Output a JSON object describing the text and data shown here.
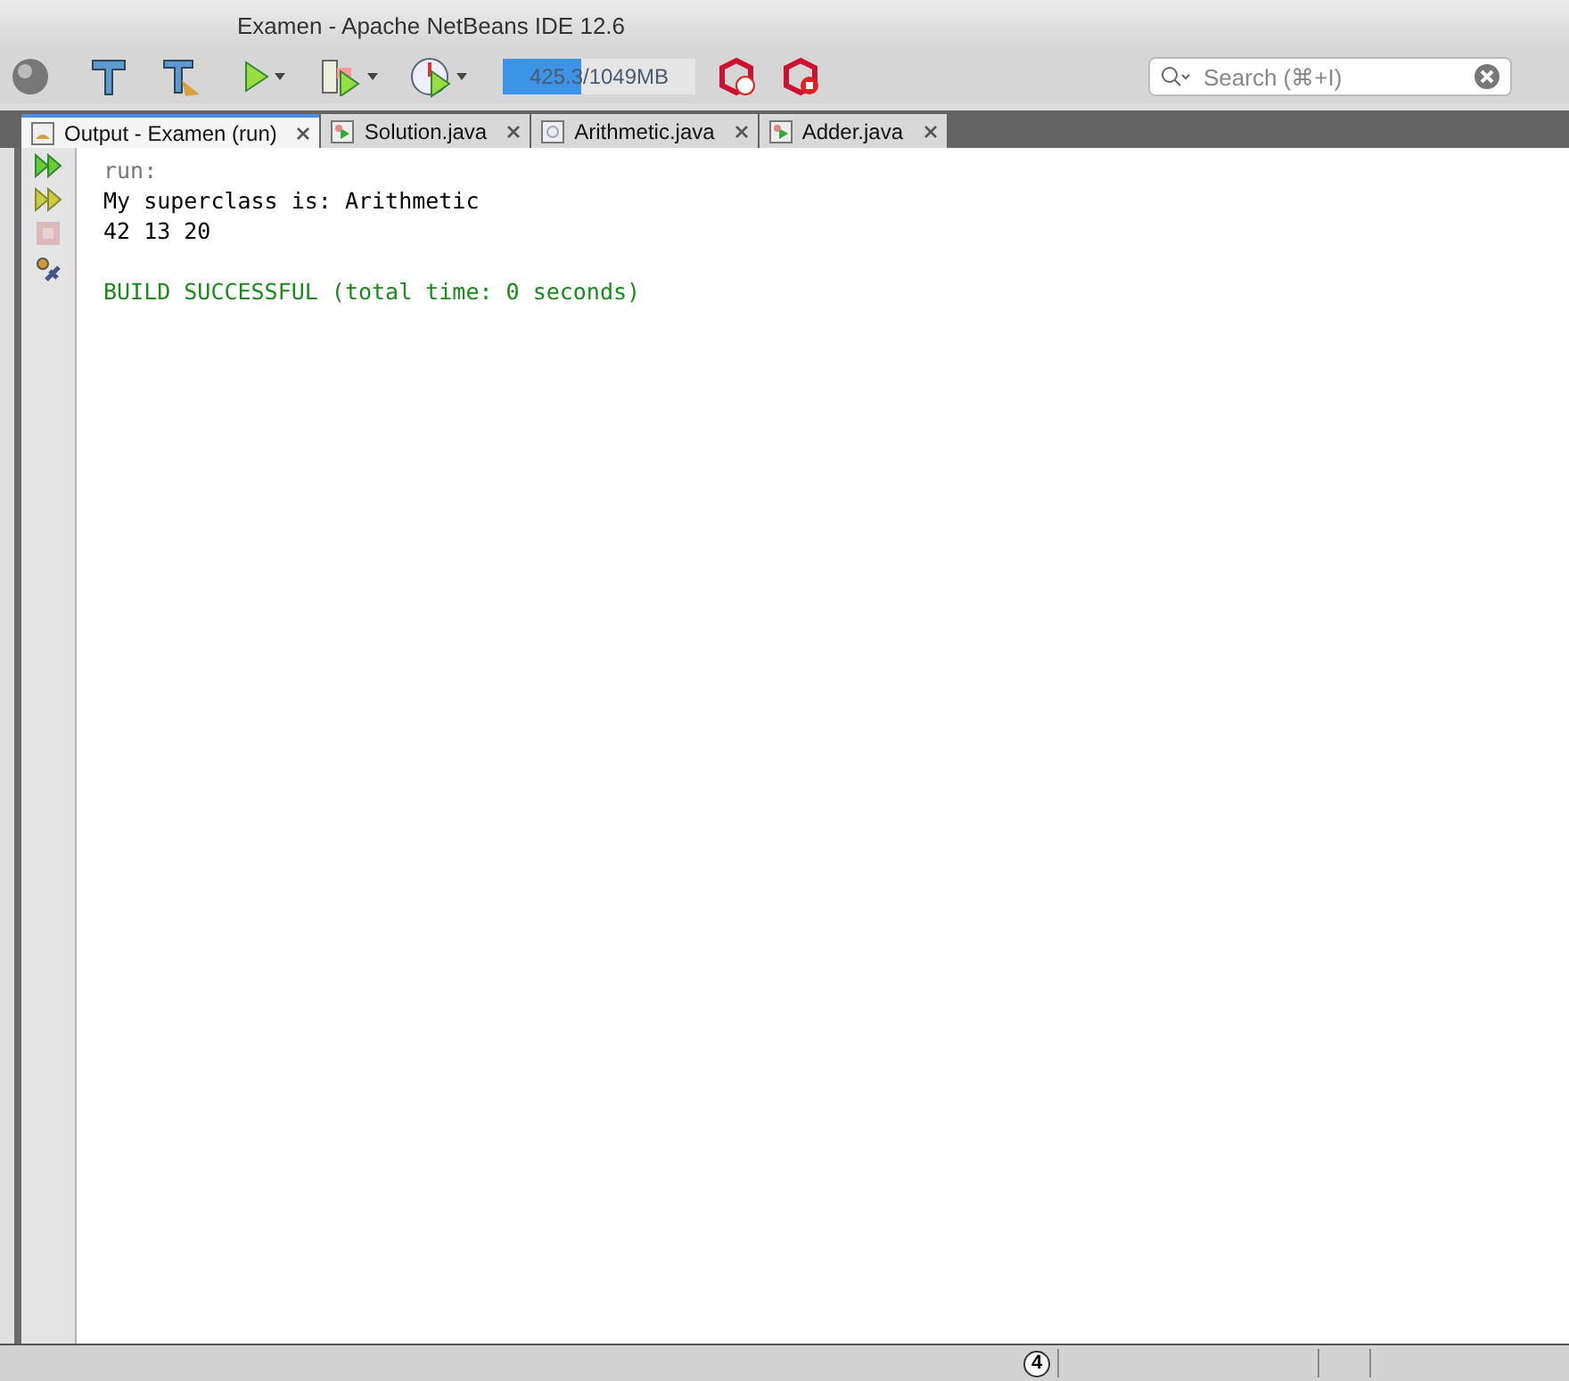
{
  "window": {
    "title": "Examen - Apache NetBeans IDE 12.6"
  },
  "toolbar": {
    "memory": {
      "reading": "425.3/1049MB",
      "level": 0.41
    },
    "search": {
      "placeholder": "Search (⌘+I)"
    }
  },
  "tabs": [
    {
      "label": "Output - Examen (run)",
      "selected": true,
      "kind": "output"
    },
    {
      "label": "Solution.java",
      "selected": false,
      "kind": "runnable"
    },
    {
      "label": "Arithmetic.java",
      "selected": false,
      "kind": "class"
    },
    {
      "label": "Adder.java",
      "selected": false,
      "kind": "runnable"
    }
  ],
  "output_actions": [
    {
      "kind": "rerun",
      "disabled": false
    },
    {
      "kind": "rerun-custom",
      "disabled": false
    },
    {
      "kind": "stop",
      "disabled": true
    },
    {
      "kind": "settings",
      "disabled": false
    }
  ],
  "output": [
    {
      "kind": "info",
      "text": "run:"
    },
    {
      "kind": "normal",
      "text": "My superclass is: Arithmetic"
    },
    {
      "kind": "normal",
      "text": "42 13 20"
    },
    {
      "kind": "blank"
    },
    {
      "kind": "success",
      "text": "BUILD SUCCESSFUL (total time: 0 seconds)"
    }
  ],
  "status_bar": {
    "notifications": "4"
  }
}
